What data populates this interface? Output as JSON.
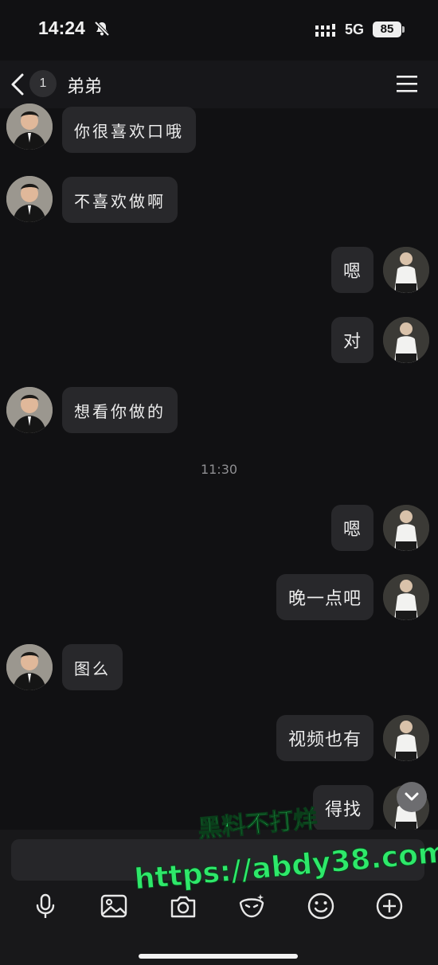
{
  "status_bar": {
    "time": "14:24",
    "network": "5G",
    "battery": "85"
  },
  "header": {
    "unread_count": "1",
    "title": "弟弟"
  },
  "messages": [
    {
      "side": "left",
      "text": "你很喜欢口哦"
    },
    {
      "side": "left",
      "text": "不喜欢做啊"
    },
    {
      "side": "right",
      "text": "嗯"
    },
    {
      "side": "right",
      "text": "对"
    },
    {
      "side": "left",
      "text": "想看你做的"
    },
    {
      "side": "right",
      "text": "嗯"
    },
    {
      "side": "right",
      "text": "晚一点吧"
    },
    {
      "side": "left",
      "text": "图么"
    },
    {
      "side": "right",
      "text": "视频也有"
    },
    {
      "side": "right",
      "text": "得找"
    }
  ],
  "timestamp": "11:30",
  "watermark": {
    "line1": "黑料不打烊",
    "line2": "https://abdy38.com",
    "color": "#2ee86a"
  },
  "toolbar": {
    "icons": [
      "microphone-icon",
      "image-icon",
      "camera-icon",
      "sticker-icon",
      "emoji-icon",
      "plus-icon"
    ]
  }
}
